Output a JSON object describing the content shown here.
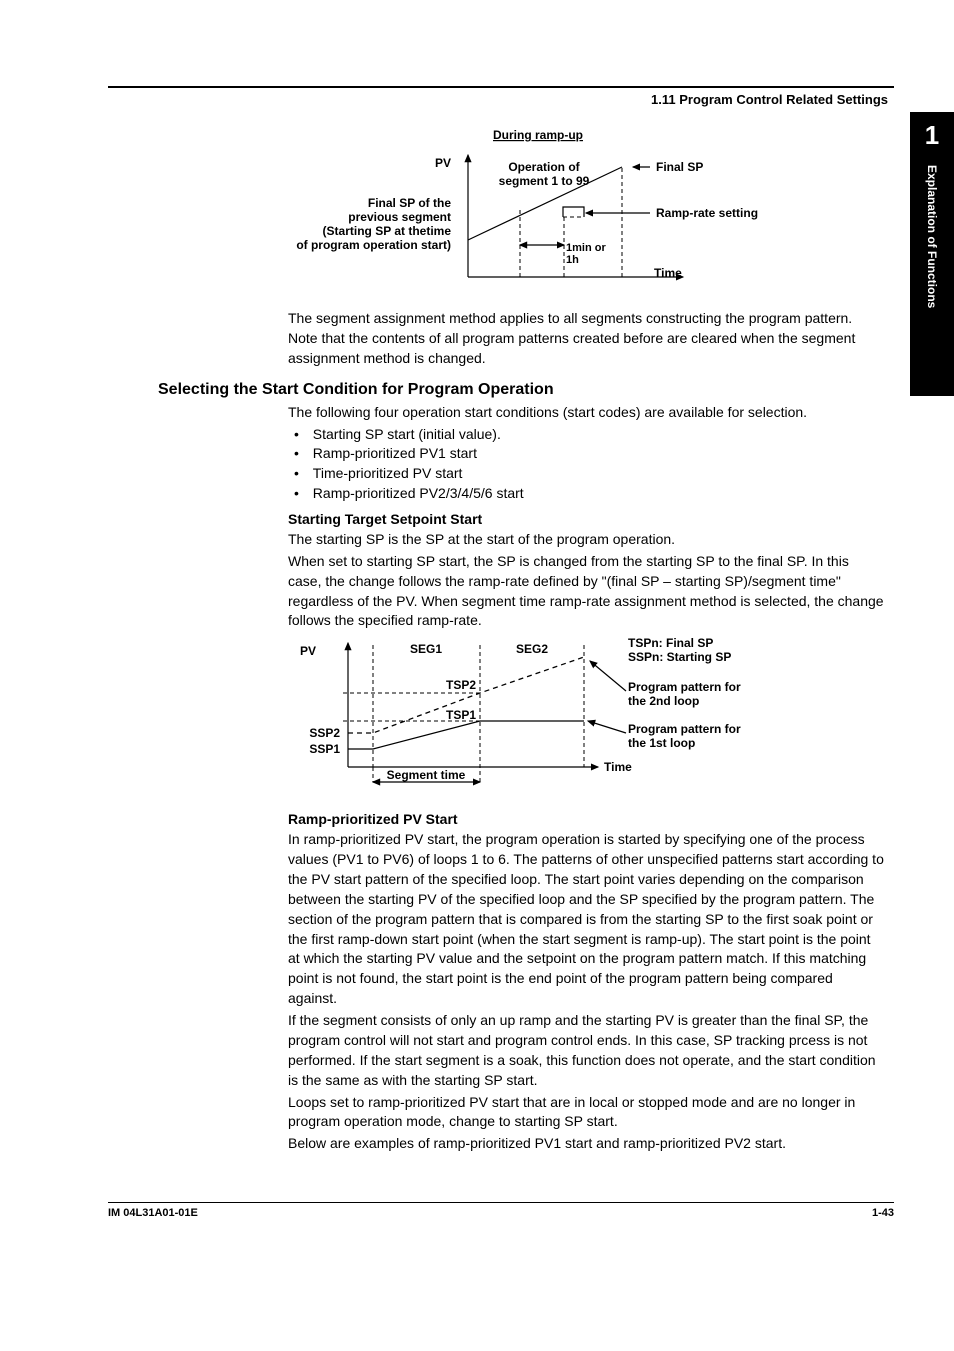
{
  "header": {
    "section": "1.11  Program Control Related Settings"
  },
  "side_tab": {
    "chapter": "1",
    "title": "Explanation of Functions"
  },
  "fig1": {
    "during": "During ramp-up",
    "pv": "PV",
    "op1": "Operation of",
    "op2": "segment 1 to 99",
    "final_sp": "Final SP",
    "ramp_rate": "Ramp-rate setting",
    "time_unit1": "1min or",
    "time_unit2": "1h",
    "time": "Time",
    "left1": "Final SP of the",
    "left2": "previous segment",
    "left3": "(Starting SP at thetime",
    "left4": "of program operation start)"
  },
  "p1": "The segment assignment method applies to all segments constructing the program pattern.  Note that the contents of all program patterns created before are cleared when the segment assignment method is changed.",
  "h2": "Selecting the Start Condition for Program Operation",
  "p2": "The following four operation start conditions (start codes) are available for selection.",
  "bullets": [
    "Starting SP start (initial value).",
    "Ramp-prioritized PV1 start",
    "Time-prioritized PV start",
    "Ramp-prioritized PV2/3/4/5/6 start"
  ],
  "sub1": "Starting Target Setpoint Start",
  "p3": "The starting SP is the SP at the start of the program operation.",
  "p4": "When set to starting SP start, the SP is changed from the starting SP to the final SP.  In this case, the change follows the ramp-rate defined by \"(final SP – starting SP)/segment time\" regardless of the PV.  When segment time ramp-rate assignment method is selected, the change follows the specified ramp-rate.",
  "fig2": {
    "pv": "PV",
    "seg1": "SEG1",
    "seg2": "SEG2",
    "tspn": "TSPn: Final SP",
    "sspn": "SSPn: Starting SP",
    "tsp2": "TSP2",
    "tsp1": "TSP1",
    "ssp2": "SSP2",
    "ssp1": "SSP1",
    "prog2a": "Program pattern for",
    "prog2b": "the 2nd loop",
    "prog1a": "Program pattern for",
    "prog1b": "the 1st loop",
    "time": "Time",
    "segtime": "Segment time"
  },
  "sub2": "Ramp-prioritized PV Start",
  "p5": "In ramp-prioritized PV start, the program operation is started by specifying one of the process values (PV1 to PV6) of loops 1 to 6.  The patterns of other unspecified patterns start according to the PV start pattern of the specified loop.  The start point varies depending on the comparison between the starting PV of the specified loop and the SP specified by the program pattern.  The section of the program pattern that is compared is from the starting SP to the first soak point or the first ramp-down start point (when the start segment is ramp-up).  The start point is the point at which the starting PV value and the setpoint on the program pattern match.  If this matching point is not found, the start point is the end point of the program pattern being compared against.",
  "p6": "If the segment consists of only an up ramp and the starting PV is greater than the final SP, the program  control  will not start and program control ends.  In this case, SP tracking prcess is not performed.  If the start segment is a soak, this function does not operate, and the start condition is the same as with the starting SP start.",
  "p7": "Loops set to ramp-prioritized PV start that are in local or stopped mode and are no longer in program operation mode, change to starting SP start.",
  "p8": "Below are examples of ramp-prioritized PV1 start and ramp-prioritized PV2 start.",
  "footer": {
    "left": "IM 04L31A01-01E",
    "right": "1-43"
  }
}
